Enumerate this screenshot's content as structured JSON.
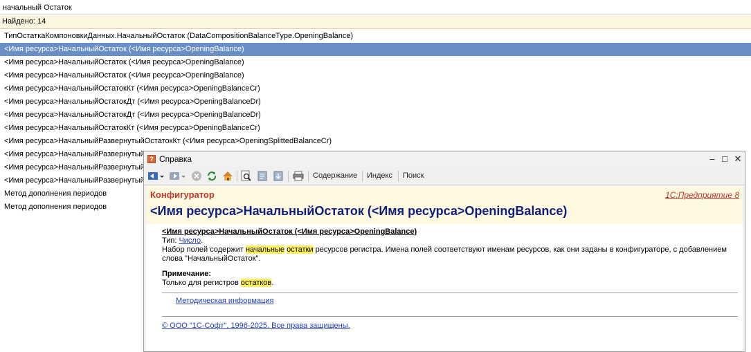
{
  "search": {
    "value": "начальный Остаток"
  },
  "found": {
    "label": "Найдено: 14"
  },
  "results": [
    "ТипОстаткаКомпоновкиДанных.НачальныйОстаток (DataCompositionBalanceType.OpeningBalance)",
    "<Имя ресурса>НачальныйОстаток (<Имя ресурса>OpeningBalance)",
    "<Имя ресурса>НачальныйОстаток (<Имя ресурса>OpeningBalance)",
    "<Имя ресурса>НачальныйОстаток (<Имя ресурса>OpeningBalance)",
    "<Имя ресурса>НачальныйОстатокКт (<Имя ресурса>OpeningBalanceCr)",
    "<Имя ресурса>НачальныйОстатокДт (<Имя ресурса>OpeningBalanceDr)",
    "<Имя ресурса>НачальныйОстатокДт (<Имя ресурса>OpeningBalanceDr)",
    "<Имя ресурса>НачальныйОстатокКт (<Имя ресурса>OpeningBalanceCr)",
    "<Имя ресурса>НачальныйРазвернутыйОстатокКт (<Имя ресурса>OpeningSplittedBalanceCr)",
    "<Имя ресурса>НачальныйРазвернутый",
    "<Имя ресурса>НачальныйРазвернутый",
    "<Имя ресурса>НачальныйРазвернутый",
    "Метод дополнения периодов",
    "Метод дополнения периодов"
  ],
  "help": {
    "window_title": "Справка",
    "app_icon_glyph": "?",
    "toolbar": {
      "contents": "Содержание",
      "index": "Индекс",
      "search": "Поиск"
    },
    "section": "Конфигуратор",
    "version": "1С:Предприятие 8",
    "title": "<Имя ресурса>НачальныйОстаток (<Имя ресурса>OpeningBalance)",
    "prop_heading": "<Имя ресурса>НачальныйОстаток (<Имя ресурса>OpeningBalance)",
    "type_label": "Тип: ",
    "type_value": "Число",
    "type_end": ".",
    "desc_prefix": "Набор полей содержит ",
    "desc_hl1": "начальные",
    "desc_space": " ",
    "desc_hl2": "остатки",
    "desc_rest": " ресурсов регистра. Имена полей соответствуют именам ресурсов, как они заданы в конфигураторе, с добавлением слова \"НачальныйОстаток\".",
    "note_heading": "Примечание:",
    "note_prefix": "Только для регистров ",
    "note_hl": "остатков",
    "note_end": ".",
    "method_link": "Методическая информация",
    "copyright": "© ООО \"1С-Софт\", 1996-2025. Все права защищены."
  },
  "colors": {
    "selection": "#6a8fc6",
    "found_bar": "#fbf7e1",
    "section_red": "#c0392b",
    "title_blue": "#0f1f7a",
    "highlight": "#fff15c",
    "link": "#2340b8"
  }
}
